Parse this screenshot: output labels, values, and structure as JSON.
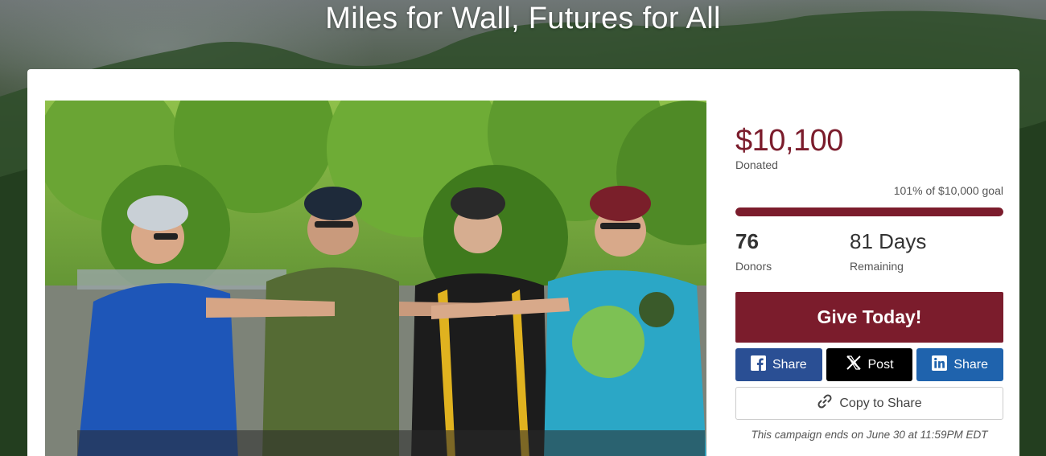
{
  "page": {
    "title": "Miles for Wall, Futures for All"
  },
  "campaign": {
    "amount": "$10,100",
    "donated_label": "Donated",
    "goal_text": "101% of $10,000 goal",
    "progress_percent": 100,
    "donors_count": "76",
    "donors_label": "Donors",
    "days_count": "81 Days",
    "days_label": "Remaining",
    "give_label": "Give Today!",
    "ends_text": "This campaign ends on June 30 at 11:59PM EDT"
  },
  "share": {
    "facebook_label": "Share",
    "x_label": "Post",
    "linkedin_label": "Share",
    "copy_label": "Copy to Share"
  },
  "icons": {
    "facebook": "facebook-icon",
    "x": "x-icon",
    "linkedin": "linkedin-icon",
    "copy": "link-icon"
  },
  "colors": {
    "brand": "#7b1c2c",
    "facebook": "#2a4f94",
    "x": "#000000",
    "linkedin": "#1f63ad"
  }
}
